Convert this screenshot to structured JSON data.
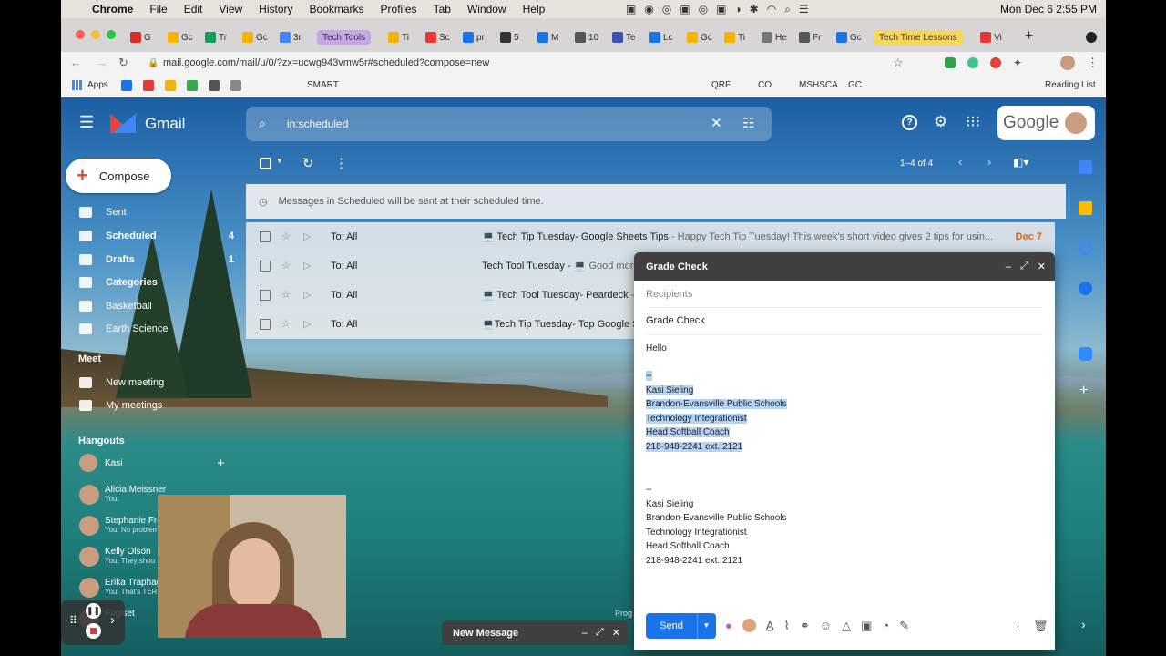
{
  "mac_menu": {
    "apple": "",
    "app": "Chrome",
    "items": [
      "File",
      "Edit",
      "View",
      "History",
      "Bookmarks",
      "Profiles",
      "Tab",
      "Window",
      "Help"
    ],
    "clock": "Mon Dec 6  2:55 PM"
  },
  "tabs": [
    {
      "label": "G",
      "color": "#d93025"
    },
    {
      "label": "Gc",
      "color": "#f4b400"
    },
    {
      "label": "Tr",
      "color": "#0f9d58"
    },
    {
      "label": "Gc",
      "color": "#f4b400"
    },
    {
      "label": "3r",
      "color": "#4285f4"
    },
    {
      "label": "Tech Tools",
      "color": "#c7a6e8",
      "pill": true
    },
    {
      "label": "Ti",
      "color": "#f4b400"
    },
    {
      "label": "Sc",
      "color": "#e53935"
    },
    {
      "label": "pr",
      "color": "#1a73e8"
    },
    {
      "label": "5",
      "color": "#333"
    },
    {
      "label": "M",
      "color": "#1a73e8"
    },
    {
      "label": "10",
      "color": "#555"
    },
    {
      "label": "Te",
      "color": "#3f51b5"
    },
    {
      "label": "Lc",
      "color": "#1a73e8"
    },
    {
      "label": "Gc",
      "color": "#f4b400"
    },
    {
      "label": "Ti",
      "color": "#f4b400"
    },
    {
      "label": "He",
      "color": "#777"
    },
    {
      "label": "Fr",
      "color": "#555"
    },
    {
      "label": "Gc",
      "color": "#1a73e8"
    },
    {
      "label": "Tech Time Lessons",
      "color": "#f7d65a",
      "pill": true
    },
    {
      "label": "Vi",
      "color": "#e53935"
    }
  ],
  "url": "mail.google.com/mail/u/0/?zx=ucwg943vmw5r#scheduled?compose=new",
  "bookmarks": {
    "apps": "Apps",
    "items": [
      "SMART",
      "QRF",
      "CO",
      "MSHSCA",
      "GC"
    ],
    "reading_list": "Reading List"
  },
  "gmail": {
    "brand": "Gmail",
    "search_value": "in:scheduled",
    "google": "Google"
  },
  "compose_button": "Compose",
  "nav": [
    {
      "label": "Sent",
      "count": ""
    },
    {
      "label": "Scheduled",
      "count": "4",
      "bold": true
    },
    {
      "label": "Drafts",
      "count": "1",
      "bold": true
    },
    {
      "label": "Categories",
      "count": "",
      "bold": true
    },
    {
      "label": "Basketball",
      "count": ""
    },
    {
      "label": "Earth Science",
      "count": ""
    }
  ],
  "meet": {
    "title": "Meet",
    "new_meeting": "New meeting",
    "my_meetings": "My meetings"
  },
  "hangouts": {
    "title": "Hangouts",
    "self": "Kasi",
    "contacts": [
      {
        "name": "Alicia Meissner",
        "preview": "You: "
      },
      {
        "name": "Stephanie Fro",
        "preview": "You: No problem"
      },
      {
        "name": "Kelly Olson",
        "preview": "You: They shou"
      },
      {
        "name": "Erika Traphag",
        "preview": "You: That's TER"
      },
      {
        "name": "Fuglset",
        "preview": ""
      }
    ]
  },
  "toolbar": {
    "pagination": "1–4 of 4"
  },
  "notice": "Messages in Scheduled will be sent at their scheduled time.",
  "messages": [
    {
      "to": "To: All",
      "subject": "💻 Tech Tip Tuesday- Google Sheets Tips",
      "snippet": " - Happy Tech Tip Tuesday! This week's short video gives 2 tips for usin...",
      "date": "Dec 7"
    },
    {
      "to": "To: All",
      "subject": "Tech Tool Tuesday - 💻",
      "snippet": " Good morni",
      "date": ""
    },
    {
      "to": "To: All",
      "subject": "💻 Tech Tool Tuesday- Peardeck",
      "snippet": " - H",
      "date": ""
    },
    {
      "to": "To: All",
      "subject": "💻Tech Tip Tuesday- Top Google Sli",
      "snippet": "",
      "date": ""
    }
  ],
  "compose": {
    "title": "Grade Check",
    "recipients_placeholder": "Recipients",
    "subject": "Grade Check",
    "body_greeting": "Hello",
    "sig_selected": [
      "--",
      "Kasi Sieling",
      "Brandon-Evansville Public Schools",
      "Technology Integrationist",
      "Head Softball Coach",
      "218-948-2241 ext. 2121"
    ],
    "sig": [
      "--",
      "Kasi Sieling",
      "Brandon-Evansville Public Schools",
      "Technology Integrationist",
      "Head Softball Coach",
      "218-948-2241 ext. 2121"
    ],
    "send": "Send"
  },
  "mini_compose": "New Message",
  "partial_text": "Prog"
}
